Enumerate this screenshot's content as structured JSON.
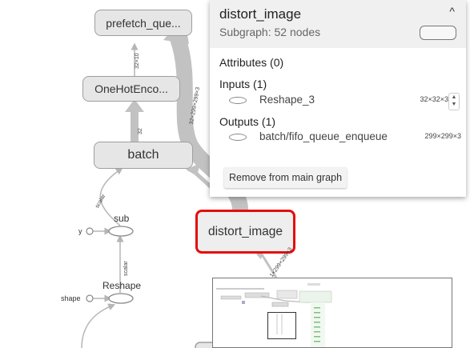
{
  "graph": {
    "nodes": {
      "prefetch_queue": "prefetch_que...",
      "onehot": "OneHotEnco...",
      "batch": "batch",
      "distort_image": "distort_image",
      "sub": "sub",
      "reshape": "Reshape",
      "y": "y",
      "shape": "shape"
    },
    "edge_labels": {
      "onehot_to_prefetch": "32×10",
      "distort_to_prefetch": "32×299×299×3",
      "batch_to_onehot": "32",
      "sub_to_batch": "scalar",
      "reshape_to_sub": "scalar",
      "distort_in": "1×299×299×3"
    }
  },
  "info_panel": {
    "title": "distort_image",
    "subtitle": "Subgraph: 52 nodes",
    "collapse_icon": "^",
    "attributes_title": "Attributes (0)",
    "inputs_title": "Inputs (1)",
    "inputs": [
      {
        "name": "Reshape_3",
        "shape": "32×32×3"
      }
    ],
    "outputs_title": "Outputs (1)",
    "outputs": [
      {
        "name": "batch/fifo_queue_enqueue",
        "shape": "299×299×3"
      }
    ],
    "remove_button": "Remove from main graph"
  },
  "colors": {
    "selected_border": "#e30d0d",
    "edge": "#b5b5b5",
    "node_fill": "#e6e6e6"
  }
}
